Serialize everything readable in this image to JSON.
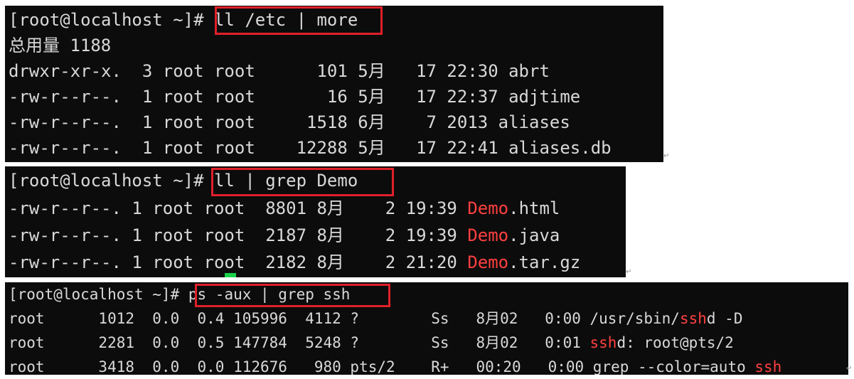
{
  "terminal1": {
    "prompt": "[root@localhost ~]# ",
    "command": "ll /etc | more",
    "lines": [
      "总用量 1188",
      "drwxr-xr-x.  3 root root      101 5月   17 22:30 abrt",
      "-rw-r--r--.  1 root root       16 5月   17 22:37 adjtime",
      "-rw-r--r--.  1 root root     1518 6月    7 2013 aliases",
      "-rw-r--r--.  1 root root    12288 5月   17 22:41 aliases.db"
    ]
  },
  "terminal2": {
    "prompt": "[root@localhost ~]# ",
    "command": "ll | grep Demo",
    "rows": [
      {
        "prefix": "-rw-r--r--. 1 root root  8801 8月    2 19:39 ",
        "match": "Demo",
        "suffix": ".html"
      },
      {
        "prefix": "-rw-r--r--. 1 root root  2187 8月    2 19:39 ",
        "match": "Demo",
        "suffix": ".java"
      },
      {
        "prefix": "-rw-r--r--. 1 root root  2182 8月    2 21:20 ",
        "match": "Demo",
        "suffix": ".tar.gz"
      }
    ]
  },
  "terminal3": {
    "prompt": "[root@localhost ~]# ",
    "command": "ps -aux | grep ssh",
    "rows": [
      {
        "prefix": "root      1012  0.0  0.4 105996  4112 ?        Ss   8月02   0:00 /usr/sbin/",
        "match": "ssh",
        "suffix": "d -D"
      },
      {
        "prefix": "root      2281  0.0  0.5 147784  5248 ?        Ss   8月02   0:01 ",
        "match": "ssh",
        "suffix": "d: root@pts/2"
      },
      {
        "prefix": "root      3418  0.0  0.0 112676   980 pts/2    R+   00:20   0:00 grep --color=auto ",
        "match": "ssh",
        "suffix": ""
      }
    ]
  },
  "colors": {
    "terminal_bg": "#0c0c0c",
    "terminal_fg": "#d9d9d9",
    "grep_match": "#ff4040",
    "highlight_box": "#e0202a",
    "cursor": "#19d24a"
  }
}
